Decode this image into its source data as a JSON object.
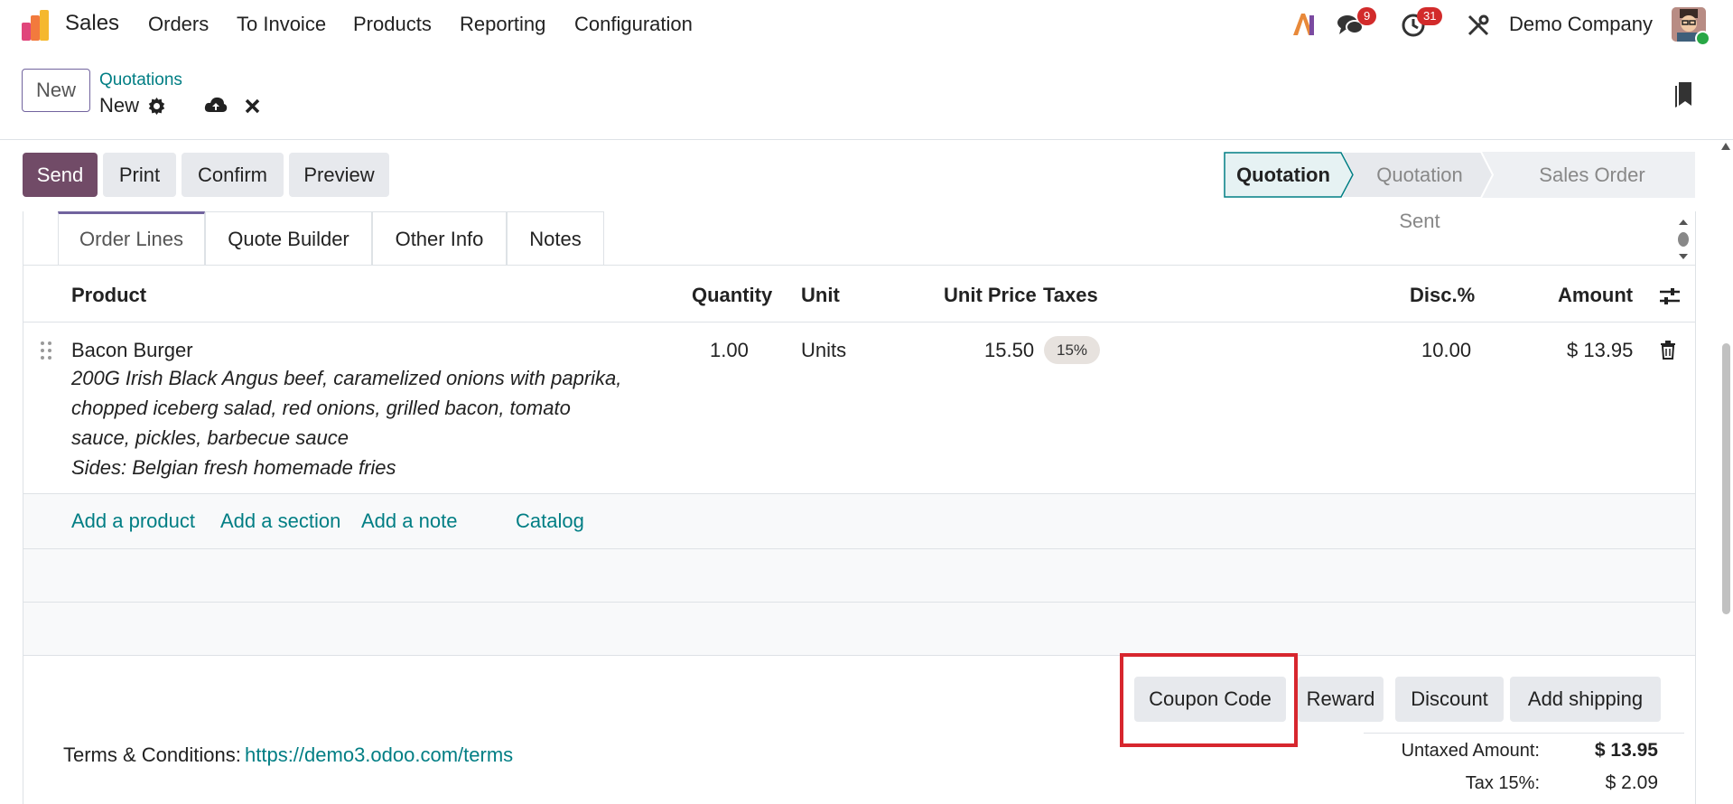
{
  "nav": {
    "app": "Sales",
    "menu": [
      "Orders",
      "To Invoice",
      "Products",
      "Reporting",
      "Configuration"
    ],
    "messages_count": "9",
    "activities_count": "31",
    "company": "Demo Company"
  },
  "control": {
    "new_label": "New",
    "breadcrumb_parent": "Quotations",
    "breadcrumb_current": "New"
  },
  "actions": {
    "send": "Send",
    "print": "Print",
    "confirm": "Confirm",
    "preview": "Preview"
  },
  "status": {
    "stages": [
      "Quotation",
      "Quotation Sent",
      "Sales Order"
    ],
    "current": "Quotation"
  },
  "tabs": [
    "Order Lines",
    "Quote Builder",
    "Other Info",
    "Notes"
  ],
  "columns": {
    "product": "Product",
    "quantity": "Quantity",
    "unit": "Unit",
    "unit_price": "Unit Price",
    "taxes": "Taxes",
    "disc": "Disc.%",
    "amount": "Amount"
  },
  "line": {
    "product": "Bacon Burger",
    "description": [
      "200G Irish Black Angus beef, caramelized onions with paprika,",
      "chopped iceberg salad, red onions, grilled bacon, tomato",
      "sauce, pickles, barbecue sauce",
      "Sides: Belgian fresh homemade fries"
    ],
    "quantity": "1.00",
    "unit": "Units",
    "unit_price": "15.50",
    "tax": "15%",
    "disc": "10.00",
    "amount": "$ 13.95"
  },
  "add_links": {
    "product": "Add a product",
    "section": "Add a section",
    "note": "Add a note",
    "catalog": "Catalog"
  },
  "footer_buttons": {
    "coupon": "Coupon Code",
    "reward": "Reward",
    "discount": "Discount",
    "shipping": "Add shipping"
  },
  "terms": {
    "label": "Terms & Conditions:",
    "url": "https://demo3.odoo.com/terms"
  },
  "totals": {
    "untaxed_label": "Untaxed Amount:",
    "untaxed_value": "$ 13.95",
    "tax_label": "Tax 15%:",
    "tax_value": "$ 2.09"
  },
  "colors": {
    "primary": "#714b67",
    "link": "#017e84",
    "highlight": "#d7262e",
    "badge": "#d22b2b"
  }
}
